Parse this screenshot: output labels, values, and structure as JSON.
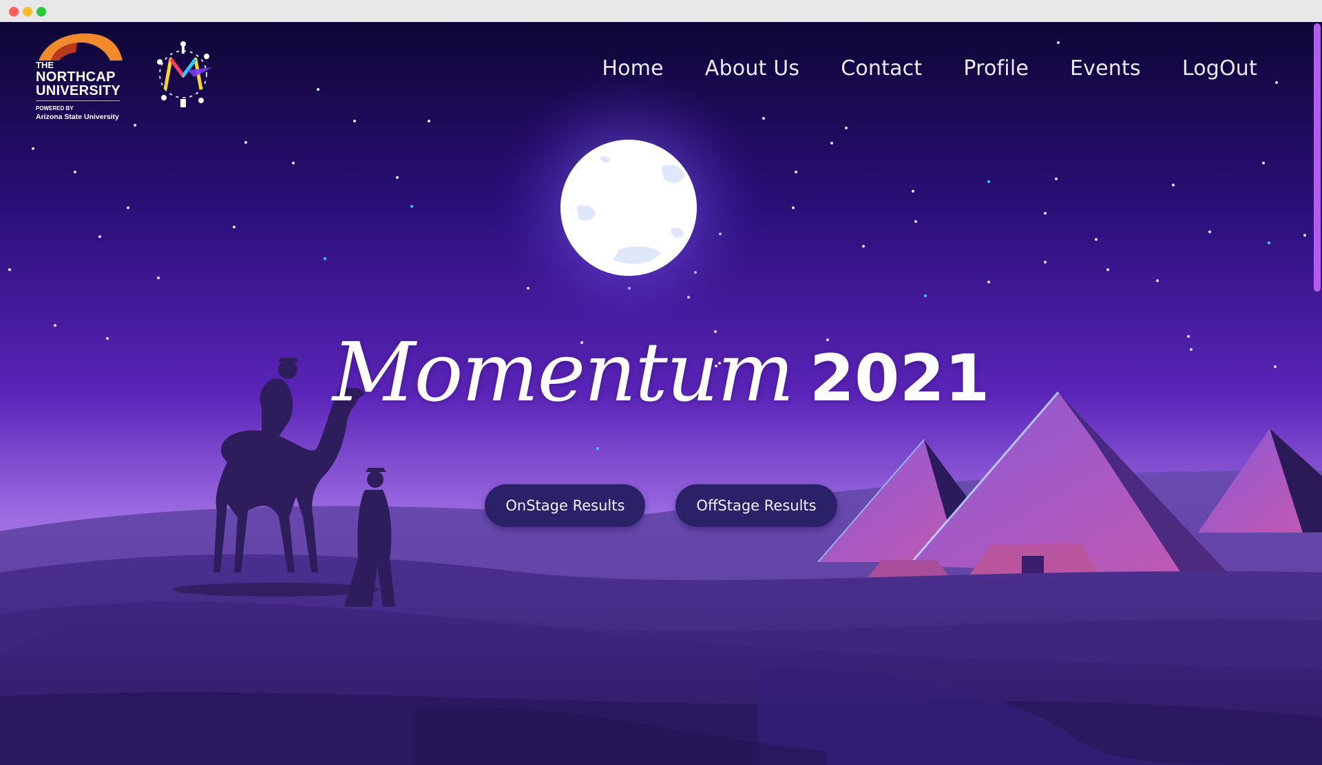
{
  "window": {
    "controls": [
      "close",
      "minimize",
      "maximize"
    ]
  },
  "branding": {
    "ncu_the": "THE",
    "ncu_line1": "NORTHCAP",
    "ncu_line2": "UNIVERSITY",
    "ncu_powered": "POWERED BY",
    "ncu_asu": "Arizona State University",
    "momentum_logo_letter": "M"
  },
  "nav": {
    "items": [
      {
        "label": "Home"
      },
      {
        "label": "About Us"
      },
      {
        "label": "Contact"
      },
      {
        "label": "Profile"
      },
      {
        "label": "Events"
      },
      {
        "label": "LogOut"
      }
    ]
  },
  "hero": {
    "title_word": "Momentum",
    "title_year": "2021",
    "buttons": {
      "onstage": "OnStage Results",
      "offstage": "OffStage Results"
    }
  },
  "colors": {
    "sky_top": "#0f0638",
    "sky_mid": "#4a1fa8",
    "horizon": "#a070e0",
    "dune_dark": "#3a2470",
    "button_bg": "#2a2168",
    "scroll_thumb": "#b45cf0",
    "arc_orange": "#f08a2c"
  },
  "icons": {
    "momentum_logo": "momentum-logo-icon",
    "ncu_logo": "ncu-logo-icon"
  }
}
